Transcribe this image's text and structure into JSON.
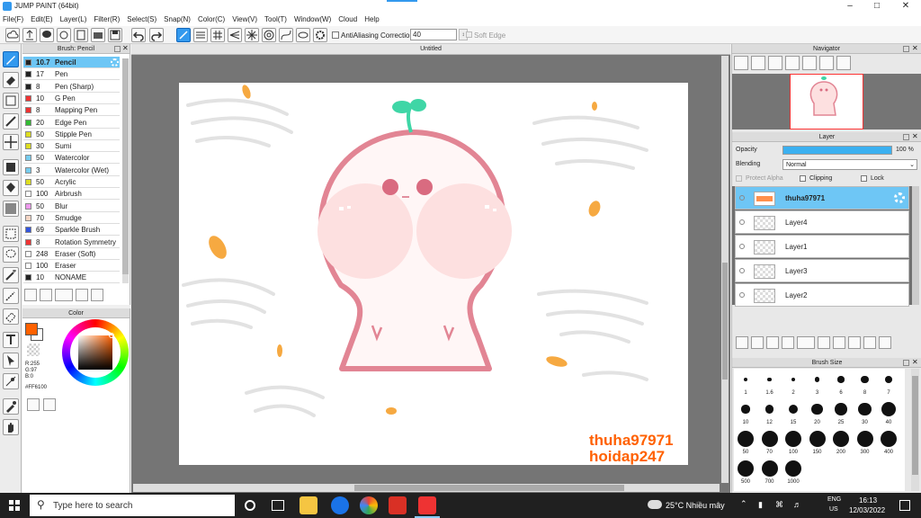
{
  "window": {
    "title": "JUMP PAINT (64bit)",
    "minimize_icon": "minimize-icon",
    "maximize_icon": "maximize-icon",
    "close_icon": "close-icon"
  },
  "menu": [
    "File(F)",
    "Edit(E)",
    "Layer(L)",
    "Filter(R)",
    "Select(S)",
    "Snap(N)",
    "Color(C)",
    "View(V)",
    "Tool(T)",
    "Window(W)",
    "Cloud",
    "Help"
  ],
  "toolbar": {
    "antialiasing_label": "AntiAliasing",
    "correction_label": "Correction",
    "correction_value": "40",
    "soft_edge_label": "Soft Edge"
  },
  "brush_panel": {
    "title": "Brush: Pencil",
    "items": [
      {
        "size": "10.7",
        "name": "Pencil",
        "color": "#222222"
      },
      {
        "size": "17",
        "name": "Pen",
        "color": "#222222"
      },
      {
        "size": "8",
        "name": "Pen (Sharp)",
        "color": "#222222"
      },
      {
        "size": "10",
        "name": "G Pen",
        "color": "#ee3333"
      },
      {
        "size": "8",
        "name": "Mapping Pen",
        "color": "#ee3333"
      },
      {
        "size": "20",
        "name": "Edge Pen",
        "color": "#33bb33"
      },
      {
        "size": "50",
        "name": "Stipple Pen",
        "color": "#dddd22"
      },
      {
        "size": "30",
        "name": "Sumi",
        "color": "#dddd22"
      },
      {
        "size": "50",
        "name": "Watercolor",
        "color": "#77ccee"
      },
      {
        "size": "3",
        "name": "Watercolor (Wet)",
        "color": "#77ccee"
      },
      {
        "size": "50",
        "name": "Acrylic",
        "color": "#dddd22"
      },
      {
        "size": "100",
        "name": "Airbrush",
        "color": "#ffffff"
      },
      {
        "size": "50",
        "name": "Blur",
        "color": "#ee99ee"
      },
      {
        "size": "70",
        "name": "Smudge",
        "color": "#f5d5c5"
      },
      {
        "size": "69",
        "name": "Sparkle Brush",
        "color": "#3355dd"
      },
      {
        "size": "8",
        "name": "Rotation Symmetry",
        "color": "#ee3333"
      },
      {
        "size": "248",
        "name": "Eraser (Soft)",
        "color": "#ffffff"
      },
      {
        "size": "100",
        "name": "Eraser",
        "color": "#ffffff"
      },
      {
        "size": "10",
        "name": "NONAME",
        "color": "#222222"
      }
    ]
  },
  "color_panel": {
    "title": "Color",
    "r": "R:255",
    "g": "G:97",
    "b": "B:0",
    "hex": "#FF6100"
  },
  "document": {
    "title": "Untitled"
  },
  "canvas": {
    "watermark_1": "thuha97971",
    "watermark_2": "hoidap247"
  },
  "navigator": {
    "title": "Navigator"
  },
  "layer_panel": {
    "title": "Layer",
    "opacity_label": "Opacity",
    "opacity_value": 100,
    "opacity_text": "100 %",
    "blending_label": "Blending",
    "blending_value": "Normal",
    "protect_alpha_label": "Protect Alpha",
    "clipping_label": "Clipping",
    "lock_label": "Lock",
    "layers": [
      "thuha97971",
      "Layer4",
      "Layer1",
      "Layer3",
      "Layer2"
    ]
  },
  "brush_size_panel": {
    "title": "Brush Size",
    "sizes": [
      "1",
      "1.6",
      "2",
      "3",
      "6",
      "8",
      "7",
      "10",
      "12",
      "15",
      "20",
      "25",
      "30",
      "40",
      "50",
      "70",
      "100",
      "150",
      "200",
      "300",
      "400",
      "500",
      "700",
      "1000"
    ]
  },
  "taskbar": {
    "search_placeholder": "Type here to search",
    "weather": "25°C  Nhiều mây",
    "lang_1": "ENG",
    "lang_2": "US",
    "time": "16:13",
    "date": "12/03/2022"
  }
}
